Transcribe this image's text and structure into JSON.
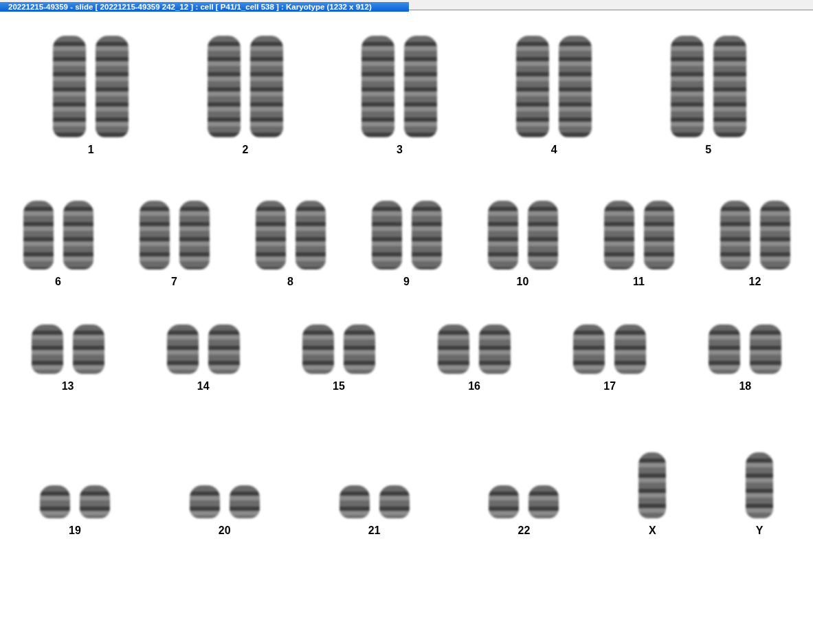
{
  "window": {
    "title": "20221215-49359 - slide [ 20221215-49359 242_12 ] : cell [ P41/1_cell 538 ] : Karyotype  (1232 x 912)"
  },
  "karyotype": {
    "rows": [
      {
        "groups": [
          {
            "label": "1",
            "kind": "pair"
          },
          {
            "label": "2",
            "kind": "pair"
          },
          {
            "label": "3",
            "kind": "pair"
          },
          {
            "label": "4",
            "kind": "pair"
          },
          {
            "label": "5",
            "kind": "pair"
          }
        ]
      },
      {
        "groups": [
          {
            "label": "6",
            "kind": "pair"
          },
          {
            "label": "7",
            "kind": "pair"
          },
          {
            "label": "8",
            "kind": "pair"
          },
          {
            "label": "9",
            "kind": "pair"
          },
          {
            "label": "10",
            "kind": "pair"
          },
          {
            "label": "11",
            "kind": "pair"
          },
          {
            "label": "12",
            "kind": "pair"
          }
        ]
      },
      {
        "groups": [
          {
            "label": "13",
            "kind": "pair"
          },
          {
            "label": "14",
            "kind": "pair"
          },
          {
            "label": "15",
            "kind": "pair"
          },
          {
            "label": "16",
            "kind": "pair"
          },
          {
            "label": "17",
            "kind": "pair"
          },
          {
            "label": "18",
            "kind": "pair"
          }
        ]
      },
      {
        "groups": [
          {
            "label": "19",
            "kind": "pair"
          },
          {
            "label": "20",
            "kind": "pair"
          },
          {
            "label": "21",
            "kind": "pair"
          },
          {
            "label": "22",
            "kind": "pair"
          },
          {
            "label": "X",
            "kind": "single"
          },
          {
            "label": "Y",
            "kind": "single"
          }
        ]
      }
    ]
  }
}
